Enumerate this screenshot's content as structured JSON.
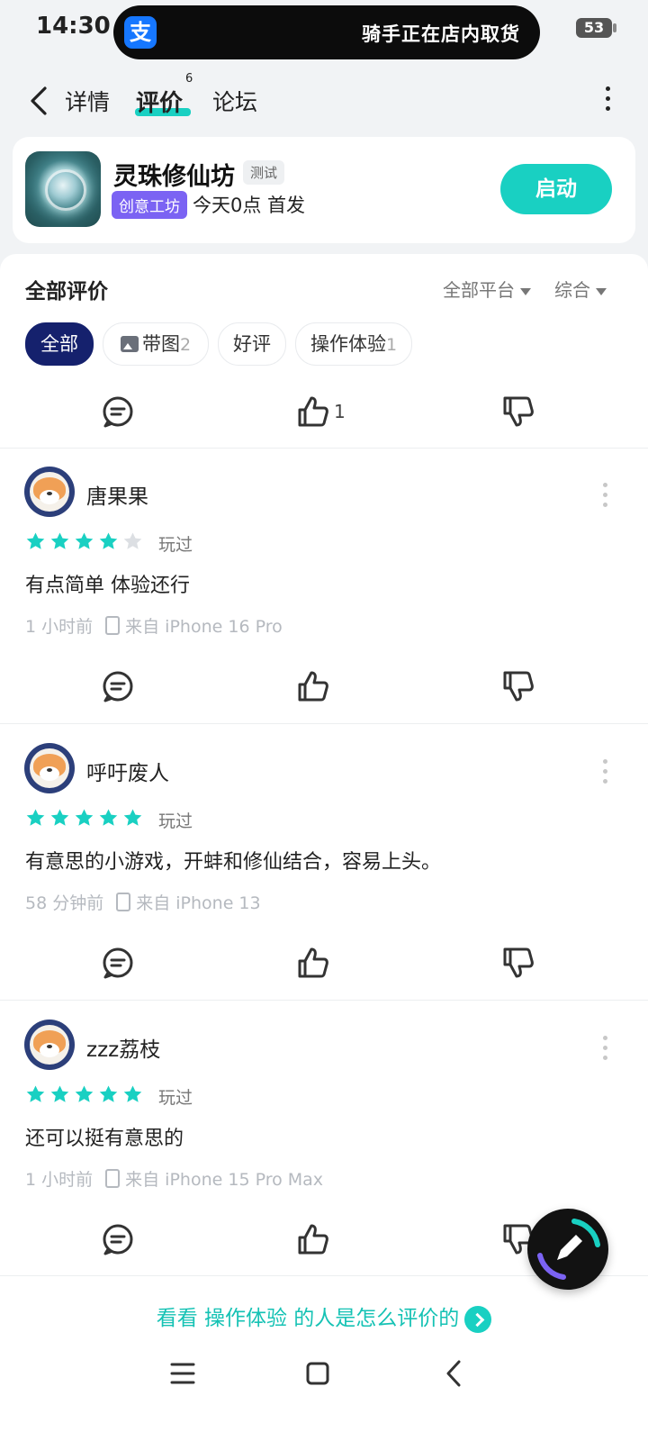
{
  "status_bar": {
    "time": "14:30",
    "live_activity_text": "骑手正在店内取货",
    "battery": "53",
    "alipay_glyph": "支"
  },
  "nav": {
    "tabs": [
      {
        "label": "详情"
      },
      {
        "label": "评价",
        "badge": "6"
      },
      {
        "label": "论坛"
      }
    ],
    "active_tab": "评价"
  },
  "app": {
    "name": "灵珠修仙坊",
    "test_tag": "测试",
    "studio_tag": "创意工坊",
    "release": "今天0点 首发",
    "launch_label": "启动"
  },
  "reviews_header": {
    "title": "全部评价",
    "platform_filter": "全部平台",
    "sort": "综合"
  },
  "chips": [
    {
      "label": "全部",
      "count": ""
    },
    {
      "label": "带图",
      "count": "2"
    },
    {
      "label": "好评",
      "count": ""
    },
    {
      "label": "操作体验",
      "count": "1"
    }
  ],
  "top_actions": {
    "like_count": "1"
  },
  "reviews": [
    {
      "user": "唐果果",
      "rating": 4,
      "played": "玩过",
      "text": "有点简单 体验还行",
      "time": "1 小时前",
      "device": "来自 iPhone 16 Pro"
    },
    {
      "user": "呼吁废人",
      "rating": 5,
      "played": "玩过",
      "text": "有意思的小游戏，开蚌和修仙结合，容易上头。",
      "time": "58 分钟前",
      "device": "来自 iPhone 13"
    },
    {
      "user": "zzz荔枝",
      "rating": 5,
      "played": "玩过",
      "text": "还可以挺有意思的",
      "time": "1 小时前",
      "device": "来自 iPhone 15 Pro Max"
    }
  ],
  "bottom_link": {
    "prefix": "看看 ",
    "highlight": "操作体验",
    "suffix": " 的人是怎么评价的"
  },
  "colors": {
    "accent": "#19d0c2",
    "chip_active": "#15216d",
    "studio_tag": "#7b63f3",
    "star": "#19d0c2",
    "star_empty": "#dcdfe3"
  },
  "icons": [
    "back-icon",
    "more-icon",
    "comment-icon",
    "thumbs-up-icon",
    "thumbs-down-icon",
    "pencil-icon",
    "menu-icon",
    "home-icon",
    "nav-back-icon",
    "image-icon",
    "phone-icon"
  ]
}
